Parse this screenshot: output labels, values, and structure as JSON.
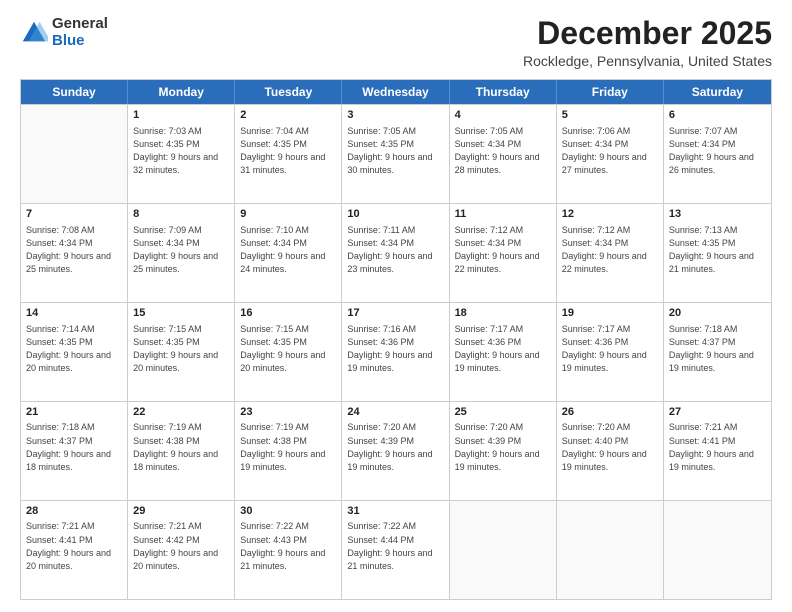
{
  "logo": {
    "general": "General",
    "blue": "Blue"
  },
  "title": "December 2025",
  "location": "Rockledge, Pennsylvania, United States",
  "days_of_week": [
    "Sunday",
    "Monday",
    "Tuesday",
    "Wednesday",
    "Thursday",
    "Friday",
    "Saturday"
  ],
  "weeks": [
    [
      {
        "day": "",
        "empty": true
      },
      {
        "day": "1",
        "sunrise": "7:03 AM",
        "sunset": "4:35 PM",
        "daylight": "9 hours and 32 minutes."
      },
      {
        "day": "2",
        "sunrise": "7:04 AM",
        "sunset": "4:35 PM",
        "daylight": "9 hours and 31 minutes."
      },
      {
        "day": "3",
        "sunrise": "7:05 AM",
        "sunset": "4:35 PM",
        "daylight": "9 hours and 30 minutes."
      },
      {
        "day": "4",
        "sunrise": "7:05 AM",
        "sunset": "4:34 PM",
        "daylight": "9 hours and 28 minutes."
      },
      {
        "day": "5",
        "sunrise": "7:06 AM",
        "sunset": "4:34 PM",
        "daylight": "9 hours and 27 minutes."
      },
      {
        "day": "6",
        "sunrise": "7:07 AM",
        "sunset": "4:34 PM",
        "daylight": "9 hours and 26 minutes."
      }
    ],
    [
      {
        "day": "7",
        "sunrise": "7:08 AM",
        "sunset": "4:34 PM",
        "daylight": "9 hours and 25 minutes."
      },
      {
        "day": "8",
        "sunrise": "7:09 AM",
        "sunset": "4:34 PM",
        "daylight": "9 hours and 25 minutes."
      },
      {
        "day": "9",
        "sunrise": "7:10 AM",
        "sunset": "4:34 PM",
        "daylight": "9 hours and 24 minutes."
      },
      {
        "day": "10",
        "sunrise": "7:11 AM",
        "sunset": "4:34 PM",
        "daylight": "9 hours and 23 minutes."
      },
      {
        "day": "11",
        "sunrise": "7:12 AM",
        "sunset": "4:34 PM",
        "daylight": "9 hours and 22 minutes."
      },
      {
        "day": "12",
        "sunrise": "7:12 AM",
        "sunset": "4:34 PM",
        "daylight": "9 hours and 22 minutes."
      },
      {
        "day": "13",
        "sunrise": "7:13 AM",
        "sunset": "4:35 PM",
        "daylight": "9 hours and 21 minutes."
      }
    ],
    [
      {
        "day": "14",
        "sunrise": "7:14 AM",
        "sunset": "4:35 PM",
        "daylight": "9 hours and 20 minutes."
      },
      {
        "day": "15",
        "sunrise": "7:15 AM",
        "sunset": "4:35 PM",
        "daylight": "9 hours and 20 minutes."
      },
      {
        "day": "16",
        "sunrise": "7:15 AM",
        "sunset": "4:35 PM",
        "daylight": "9 hours and 20 minutes."
      },
      {
        "day": "17",
        "sunrise": "7:16 AM",
        "sunset": "4:36 PM",
        "daylight": "9 hours and 19 minutes."
      },
      {
        "day": "18",
        "sunrise": "7:17 AM",
        "sunset": "4:36 PM",
        "daylight": "9 hours and 19 minutes."
      },
      {
        "day": "19",
        "sunrise": "7:17 AM",
        "sunset": "4:36 PM",
        "daylight": "9 hours and 19 minutes."
      },
      {
        "day": "20",
        "sunrise": "7:18 AM",
        "sunset": "4:37 PM",
        "daylight": "9 hours and 19 minutes."
      }
    ],
    [
      {
        "day": "21",
        "sunrise": "7:18 AM",
        "sunset": "4:37 PM",
        "daylight": "9 hours and 18 minutes."
      },
      {
        "day": "22",
        "sunrise": "7:19 AM",
        "sunset": "4:38 PM",
        "daylight": "9 hours and 18 minutes."
      },
      {
        "day": "23",
        "sunrise": "7:19 AM",
        "sunset": "4:38 PM",
        "daylight": "9 hours and 19 minutes."
      },
      {
        "day": "24",
        "sunrise": "7:20 AM",
        "sunset": "4:39 PM",
        "daylight": "9 hours and 19 minutes."
      },
      {
        "day": "25",
        "sunrise": "7:20 AM",
        "sunset": "4:39 PM",
        "daylight": "9 hours and 19 minutes."
      },
      {
        "day": "26",
        "sunrise": "7:20 AM",
        "sunset": "4:40 PM",
        "daylight": "9 hours and 19 minutes."
      },
      {
        "day": "27",
        "sunrise": "7:21 AM",
        "sunset": "4:41 PM",
        "daylight": "9 hours and 19 minutes."
      }
    ],
    [
      {
        "day": "28",
        "sunrise": "7:21 AM",
        "sunset": "4:41 PM",
        "daylight": "9 hours and 20 minutes."
      },
      {
        "day": "29",
        "sunrise": "7:21 AM",
        "sunset": "4:42 PM",
        "daylight": "9 hours and 20 minutes."
      },
      {
        "day": "30",
        "sunrise": "7:22 AM",
        "sunset": "4:43 PM",
        "daylight": "9 hours and 21 minutes."
      },
      {
        "day": "31",
        "sunrise": "7:22 AM",
        "sunset": "4:44 PM",
        "daylight": "9 hours and 21 minutes."
      },
      {
        "day": "",
        "empty": true
      },
      {
        "day": "",
        "empty": true
      },
      {
        "day": "",
        "empty": true
      }
    ]
  ]
}
